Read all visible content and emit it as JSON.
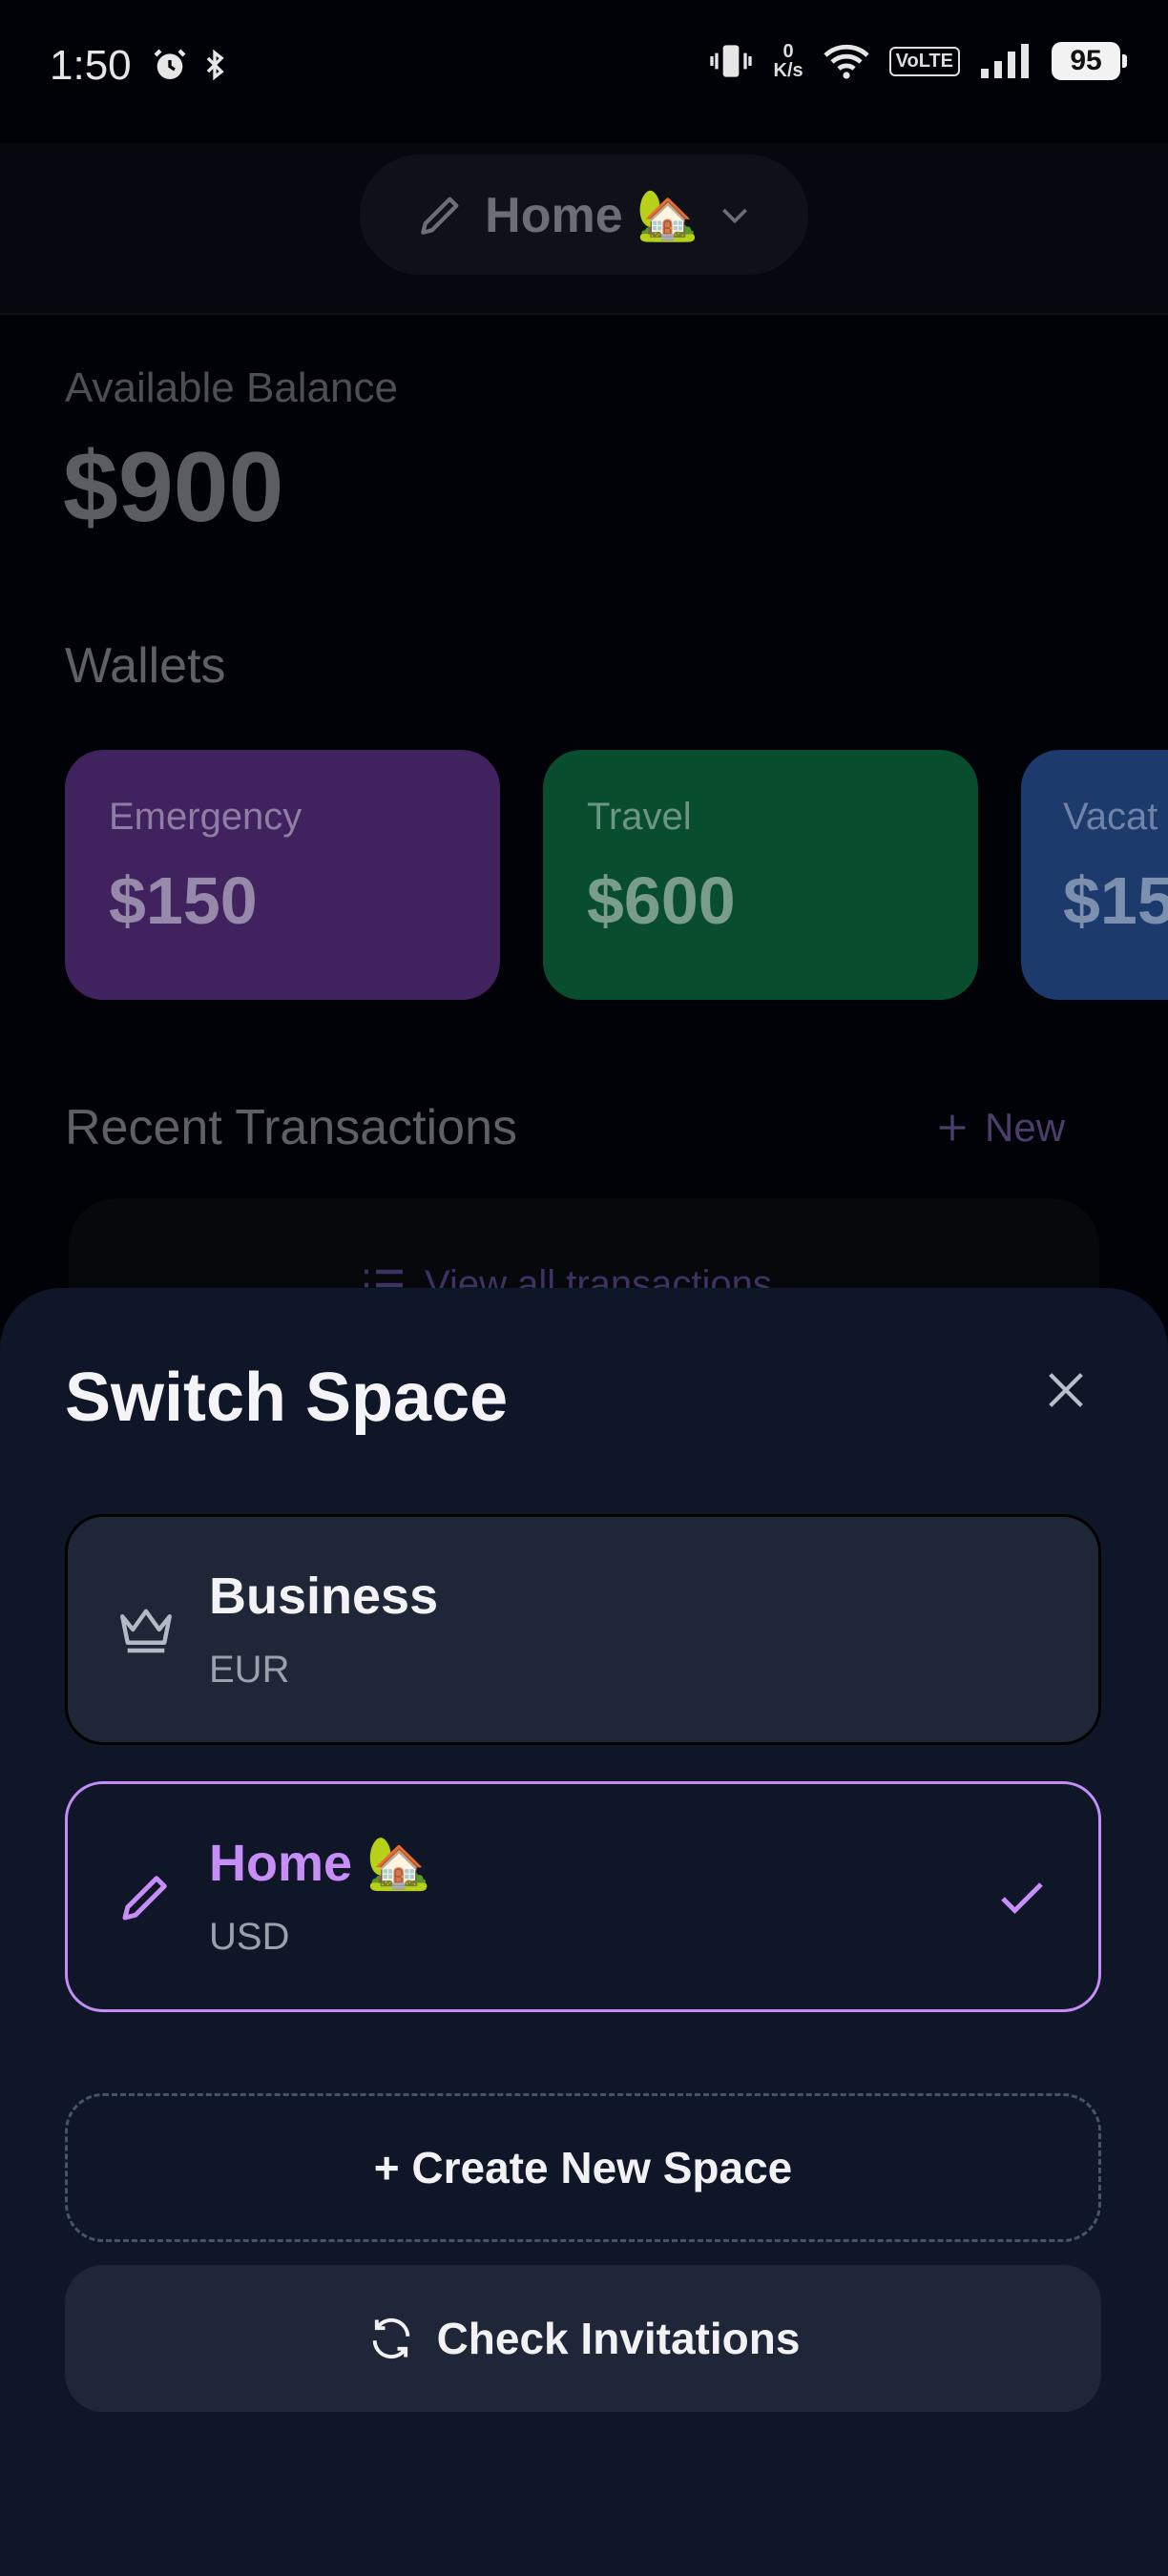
{
  "status_bar": {
    "time": "1:50",
    "net_speed_top": "0",
    "net_speed_bottom": "K/s",
    "volte": "VoLTE",
    "battery": "95"
  },
  "header": {
    "space_label": "Home 🏡"
  },
  "balance": {
    "label": "Available Balance",
    "value": "$900"
  },
  "wallets": {
    "title": "Wallets",
    "items": [
      {
        "name": "Emergency",
        "amount": "$150",
        "color": "#40225f"
      },
      {
        "name": "Travel",
        "amount": "$600",
        "color": "#084d2e"
      },
      {
        "name": "Vacat",
        "amount": "$15",
        "color": "#1c3a6b"
      }
    ]
  },
  "transactions": {
    "title": "Recent Transactions",
    "new_label": "New",
    "view_all_label": "View all transactions"
  },
  "sheet": {
    "title": "Switch Space",
    "spaces": [
      {
        "name": "Business",
        "currency": "EUR",
        "icon": "crown-icon",
        "selected": false
      },
      {
        "name": "Home 🏡",
        "currency": "USD",
        "icon": "pencil-icon",
        "selected": true
      }
    ],
    "create_label": "+ Create New Space",
    "invitations_label": "Check Invitations"
  },
  "colors": {
    "accent": "#c48cf5",
    "sheet_bg": "#0e1628",
    "card_bg": "#1e2637"
  }
}
